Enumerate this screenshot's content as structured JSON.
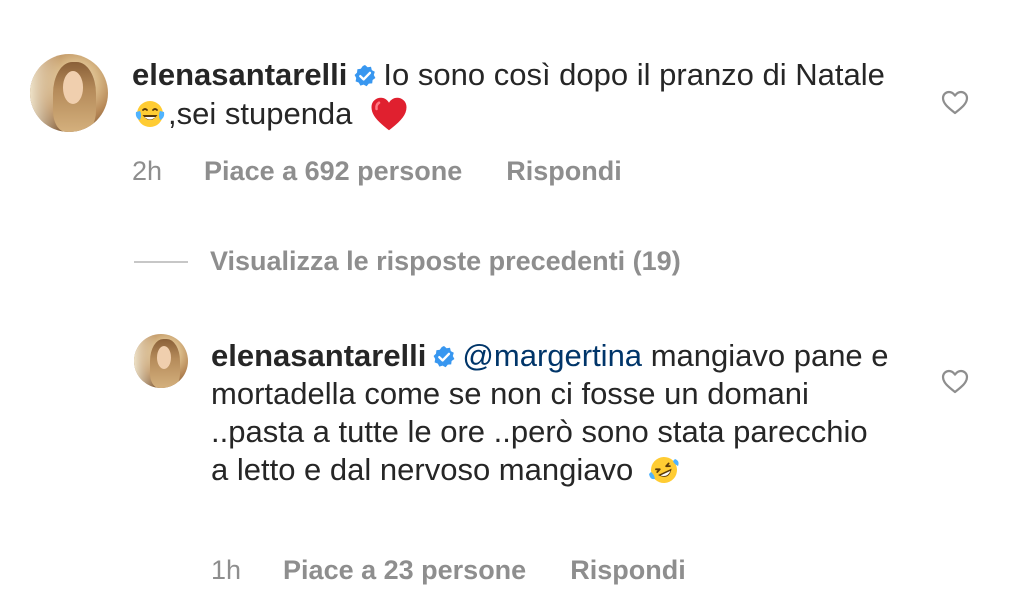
{
  "comments": [
    {
      "username": "elenasantarelli",
      "text_before": "Io sono così dopo il pranzo di Natale",
      "text_after": ",sei stupenda",
      "time": "2h",
      "likes": "Piace a 692 persone",
      "reply": "Rispondi"
    },
    {
      "username": "elenasantarelli",
      "mention": "@margertina",
      "text": "mangiavo pane e mortadella come se non ci fosse un domani ..pasta a tutte le ore ..però sono stata parecchio a letto e dal nervoso mangiavo",
      "time": "1h",
      "likes": "Piace a 23 persone",
      "reply": "Rispondi"
    }
  ],
  "view_previous_replies": "Visualizza le risposte precedenti (19)",
  "icons": {
    "verified": "verified-badge-icon",
    "laugh_emoji": "face-with-tears-of-joy-emoji",
    "heart_emoji": "red-heart-emoji",
    "rofl_emoji": "rolling-on-floor-laughing-emoji",
    "like": "heart-outline-icon"
  },
  "colors": {
    "text": "#262626",
    "secondary": "#8e8e8e",
    "mention": "#003569",
    "verified": "#3897f0",
    "heart": "#ed4956"
  }
}
